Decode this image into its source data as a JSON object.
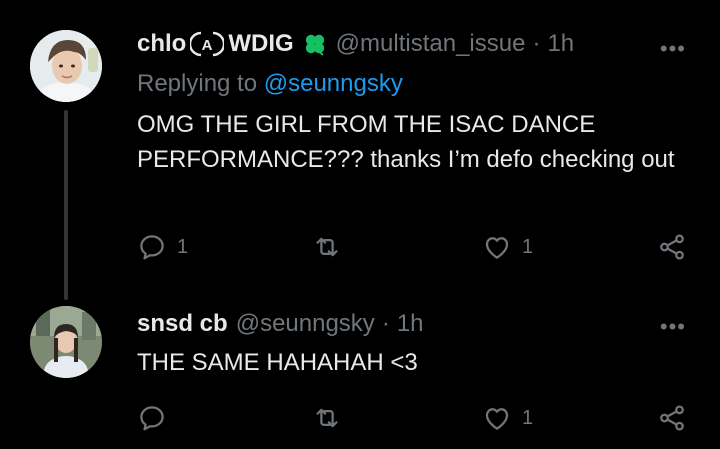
{
  "tweets": [
    {
      "name": "chlo",
      "name_suffix": "WDIG",
      "handle": "@multistan_issue",
      "separator": "·",
      "time": "1h",
      "replying_label": "Replying to",
      "replying_to": "@seunngsky",
      "text": "OMG THE GIRL FROM THE ISAC DANCE PERFORMANCE??? thanks I’m defo checking out",
      "reply_count": "1",
      "retweet_count": "",
      "like_count": "1",
      "more": "•••"
    },
    {
      "name": "snsd cb",
      "handle": "@seunngsky",
      "separator": "·",
      "time": "1h",
      "text": "THE SAME HAHAHAH <3",
      "reply_count": "",
      "retweet_count": "",
      "like_count": "1",
      "more": "•••"
    }
  ],
  "icons": {
    "reply": "reply-icon",
    "retweet": "retweet-icon",
    "like": "heart-icon",
    "share": "share-icon",
    "more": "more-icon",
    "clover": "clover-icon",
    "circle_a": "circled-a-icon"
  },
  "colors": {
    "background": "#000000",
    "text": "#e7e9ea",
    "muted": "#71767b",
    "link": "#1d9bf0",
    "clover": "#17bf63"
  }
}
